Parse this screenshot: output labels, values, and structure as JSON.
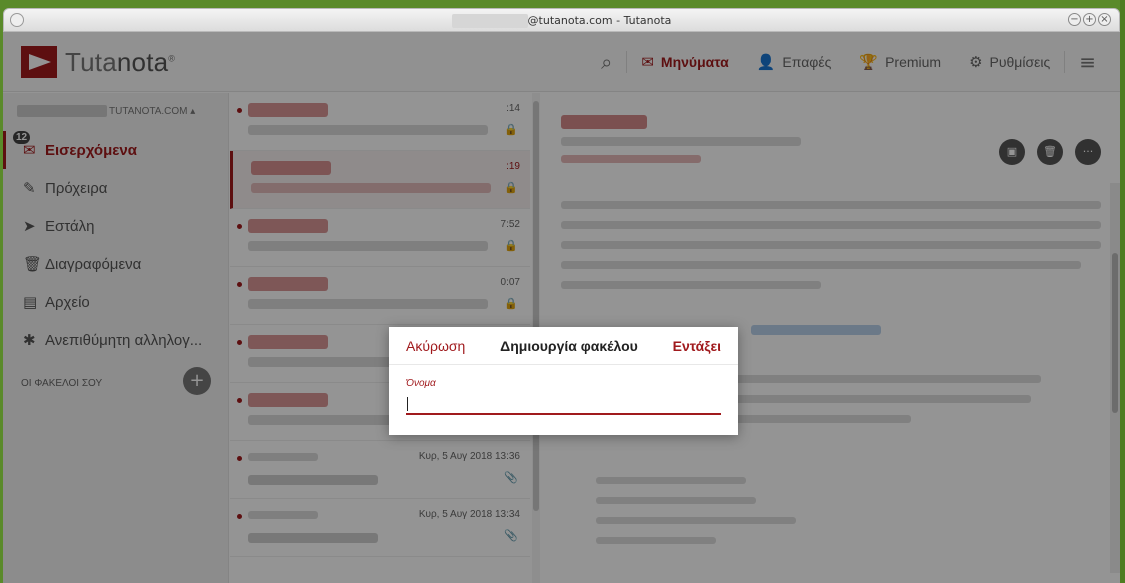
{
  "window": {
    "title_suffix": "@tutanota.com - Tutanota",
    "buttons": [
      "−",
      "+",
      "×"
    ]
  },
  "header": {
    "logo_text_a": "Tuta",
    "logo_text_b": "nota",
    "logo_mark": "®",
    "nav": [
      {
        "label": "Μηνύματα",
        "icon": "mail-icon",
        "glyph": "✉"
      },
      {
        "label": "Επαφές",
        "icon": "contacts-icon",
        "glyph": "👤"
      },
      {
        "label": "Premium",
        "icon": "trophy-icon",
        "glyph": "🏆"
      },
      {
        "label": "Ρυθμίσεις",
        "icon": "gear-icon",
        "glyph": "⚙"
      }
    ],
    "search_glyph": "⌕",
    "menu_glyph": "≡"
  },
  "sidebar": {
    "account_suffix": "TUTANOTA.COM ▴",
    "inbox_badge": "12",
    "folders": [
      {
        "label": "Εισερχόμενα",
        "glyph": "✉"
      },
      {
        "label": "Πρόχειρα",
        "glyph": "✎"
      },
      {
        "label": "Εστάλη",
        "glyph": "➤"
      },
      {
        "label": "Διαγραφόμενα",
        "glyph": "🗑"
      },
      {
        "label": "Αρχείο",
        "glyph": "▤"
      },
      {
        "label": "Ανεπιθύμητη αλληλογ...",
        "glyph": "✱"
      }
    ],
    "your_folders": "ΟΙ ΦΑΚΕΛΟΙ ΣΟΥ",
    "add_glyph": "+"
  },
  "maillist": {
    "items": [
      {
        "time": ":14",
        "icon": "🔒"
      },
      {
        "time": ":19",
        "icon": "🔒"
      },
      {
        "time": "7:52",
        "icon": "🔒"
      },
      {
        "time": "0:07",
        "icon": "🔒"
      },
      {
        "time": "",
        "icon": ""
      },
      {
        "time": "",
        "icon": ""
      },
      {
        "time": "Κυρ, 5 Αυγ 2018 13:36",
        "icon": "📎"
      },
      {
        "time": "Κυρ, 5 Αυγ 2018 13:34",
        "icon": "📎"
      }
    ]
  },
  "reader": {
    "action_glyphs": [
      "▣",
      "🗑",
      "···"
    ]
  },
  "dialog": {
    "cancel": "Ακύρωση",
    "title": "Δημιουργία φακέλου",
    "ok": "Εντάξει",
    "field_label": "Όνομα",
    "field_value": ""
  }
}
